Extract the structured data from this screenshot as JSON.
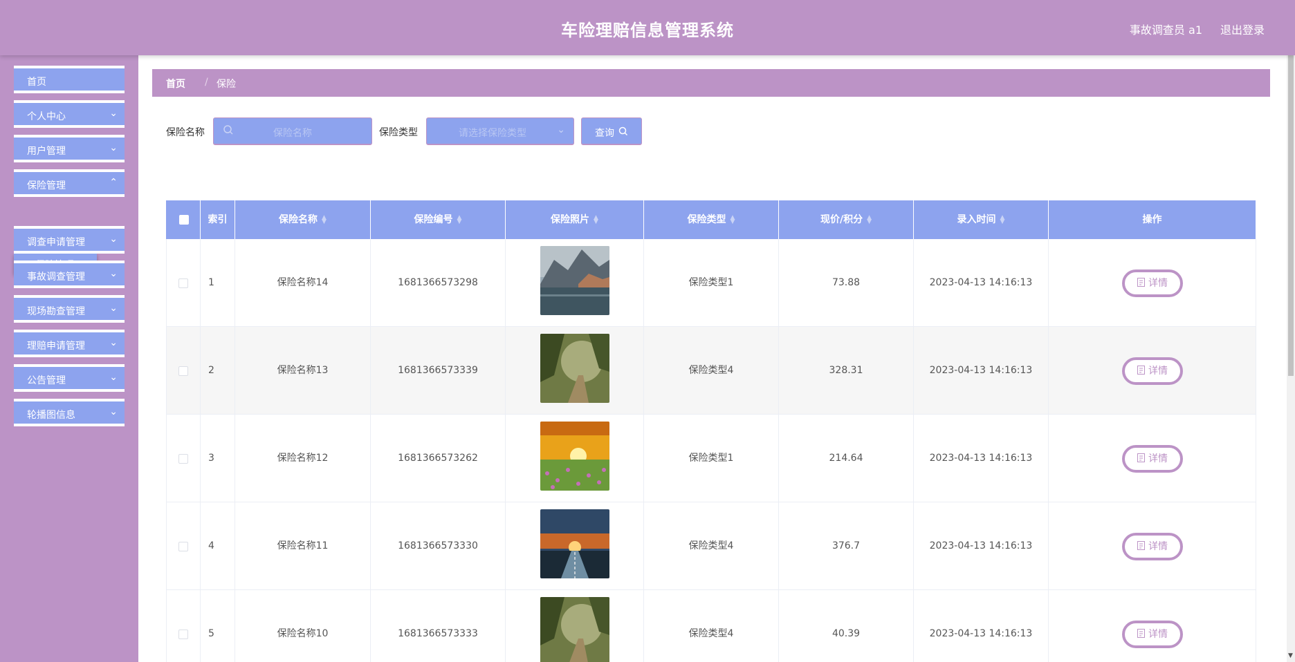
{
  "header": {
    "title": "车险理赔信息管理系统",
    "user": "事故调查员 a1",
    "logout": "退出登录"
  },
  "sidebar": {
    "items": [
      {
        "label": "首页",
        "has_arrow": false
      },
      {
        "label": "个人中心",
        "has_arrow": true
      },
      {
        "label": "用户管理",
        "has_arrow": true
      },
      {
        "label": "保险管理",
        "has_arrow": true
      },
      {
        "label": "调查申请管理",
        "has_arrow": true
      },
      {
        "label": "事故调查管理",
        "has_arrow": true
      },
      {
        "label": "现场勘查管理",
        "has_arrow": true
      },
      {
        "label": "理赔申请管理",
        "has_arrow": true
      },
      {
        "label": "公告管理",
        "has_arrow": true
      },
      {
        "label": "轮播图信息",
        "has_arrow": true
      }
    ],
    "submenu": {
      "label": "保险管理"
    }
  },
  "breadcrumb": {
    "home": "首页",
    "separator": "/",
    "current": "保险"
  },
  "filters": {
    "name_label": "保险名称",
    "name_placeholder": "保险名称",
    "type_label": "保险类型",
    "type_placeholder": "请选择保险类型",
    "query_button": "查询"
  },
  "table": {
    "columns": [
      "索引",
      "保险名称",
      "保险编号",
      "保险照片",
      "保险类型",
      "现价/积分",
      "录入时间",
      "操作"
    ],
    "rows": [
      {
        "index": "1",
        "name": "保险名称14",
        "code": "1681366573298",
        "photo": "lake-village",
        "type": "保险类型1",
        "price": "73.88",
        "time": "2023-04-13 14:16:13",
        "action": "详情"
      },
      {
        "index": "2",
        "name": "保险名称13",
        "code": "1681366573339",
        "photo": "forest-path",
        "type": "保险类型4",
        "price": "328.31",
        "time": "2023-04-13 14:16:13",
        "action": "详情"
      },
      {
        "index": "3",
        "name": "保险名称12",
        "code": "1681366573262",
        "photo": "sunset-flowers",
        "type": "保险类型1",
        "price": "214.64",
        "time": "2023-04-13 14:16:13",
        "action": "详情"
      },
      {
        "index": "4",
        "name": "保险名称11",
        "code": "1681366573330",
        "photo": "sunset-road",
        "type": "保险类型4",
        "price": "376.7",
        "time": "2023-04-13 14:16:13",
        "action": "详情"
      },
      {
        "index": "5",
        "name": "保险名称10",
        "code": "1681366573333",
        "photo": "forest-path",
        "type": "保险类型4",
        "price": "40.39",
        "time": "2023-04-13 14:16:13",
        "action": "详情"
      }
    ]
  },
  "colors": {
    "header_bg": "#bc93c6",
    "menu_bg": "#8da3ee",
    "table_header_bg": "#8da3ee",
    "accent": "#bc93c6"
  }
}
